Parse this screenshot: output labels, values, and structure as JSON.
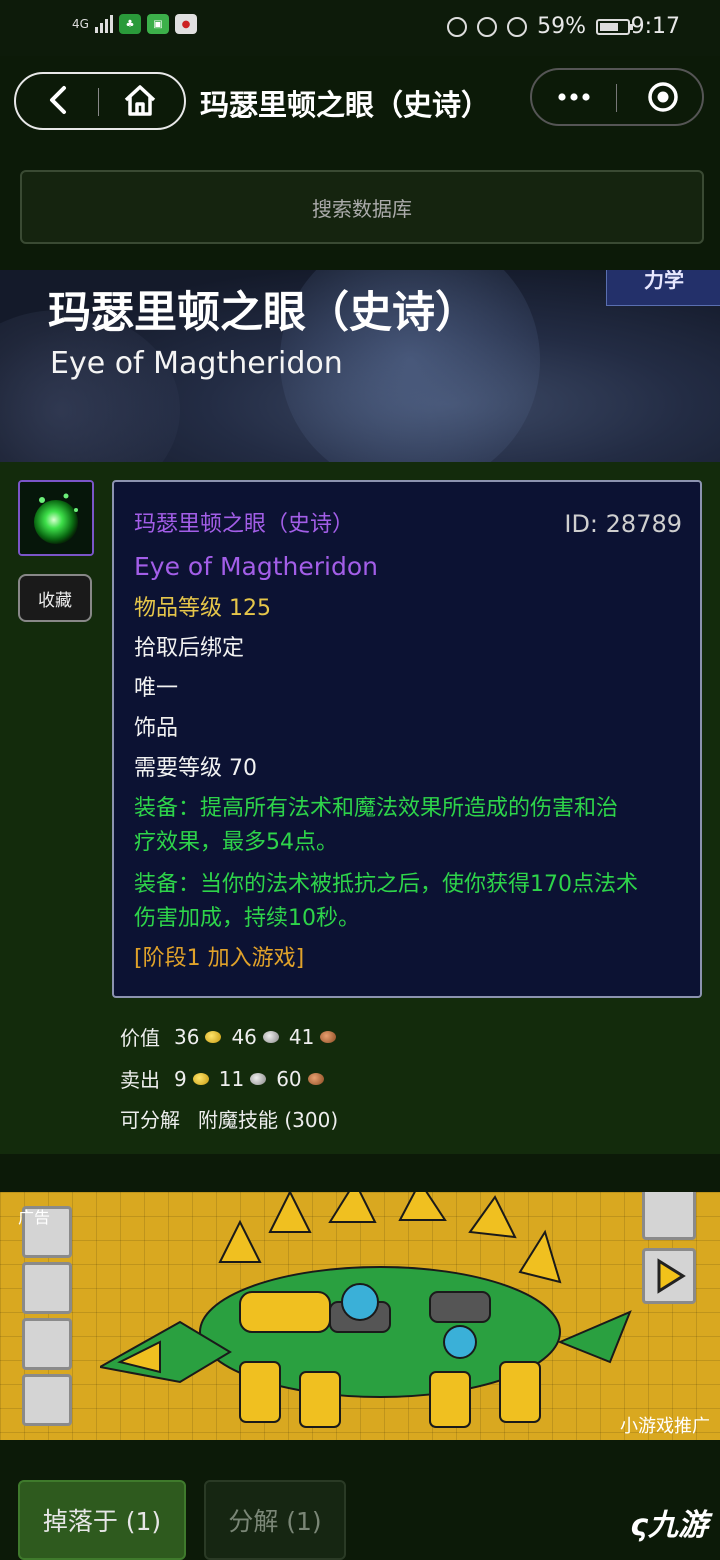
{
  "status_bar": {
    "signal": "4G",
    "battery": "59%",
    "time": "9:17",
    "app_icons": [
      "green-app-icon",
      "green-app-icon-2",
      "game-app-icon"
    ]
  },
  "nav": {
    "title": "玛瑟里顿之眼（史诗）"
  },
  "search": {
    "placeholder": "搜索数据库"
  },
  "banner": {
    "title_cn": "玛瑟里顿之眼（史诗）",
    "title_en": "Eye of Magtheridon",
    "tag": "力学"
  },
  "item": {
    "favorite_label": "收藏",
    "name_cn": "玛瑟里顿之眼（史诗）",
    "id": "ID: 28789",
    "name_en": "Eye of Magtheridon",
    "item_level": "物品等级 125",
    "binding": "拾取后绑定",
    "unique": "唯一",
    "slot": "饰品",
    "required_level": "需要等级 70",
    "effect1_line1": "装备：提高所有法术和魔法效果所造成的伤害和治",
    "effect1_line2": "疗效果，最多54点。",
    "effect2_line1": "装备：当你的法术被抵抗之后，使你获得170点法术",
    "effect2_line2": "伤害加成，持续10秒。",
    "phase": "[阶段1 加入游戏]"
  },
  "economy": {
    "value_label": "价值",
    "value_gold": "36",
    "value_silver": "46",
    "value_copper": "41",
    "sell_label": "卖出",
    "sell_gold": "9",
    "sell_silver": "11",
    "sell_copper": "60",
    "disenchant_label": "可分解",
    "disenchant_skill": "附魔技能 (300)"
  },
  "ad": {
    "label": "广告",
    "promo": "小游戏推广"
  },
  "tabs": {
    "drop": "掉落于 (1)",
    "disenchant": "分解 (1)"
  },
  "watermark": "九游",
  "colors": {
    "quality_epic": "#a35ee8",
    "item_level": "#e6c64a",
    "equip_effect": "#2ed44a",
    "phase": "#e0a22a",
    "page_bg": "#132b0c"
  }
}
